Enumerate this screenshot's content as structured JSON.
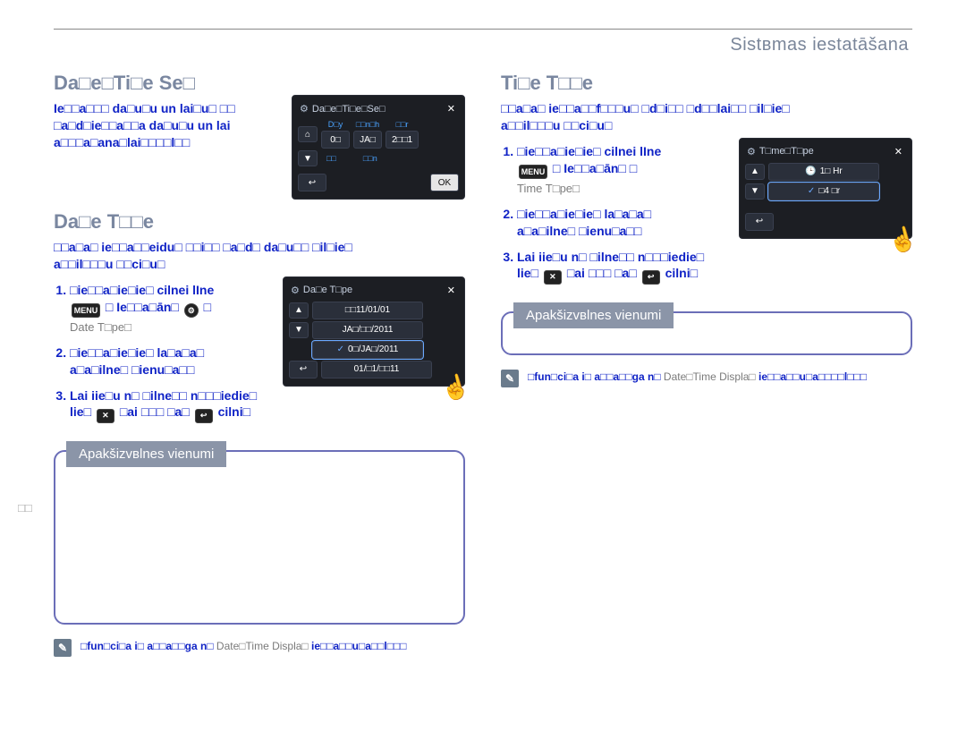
{
  "header_right": "Sistвmas iestatāšana",
  "left": {
    "h1": "Da□e□Ti□e Se□",
    "lede": "Ie□□a□□□ da□u□u un lai□u□ □□\n□a□d□ie□□a□□a da□u□u un lai\na□□□a□ana□lai□□□□l□□",
    "h2": "Da□e T□□e",
    "lede2": "□□a□a□ ie□□a□□eidu□ □□i□□ □a□d□ da□u□□ □il□ie□\na□□il□□□u □□ci□u□",
    "steps": [
      "□ie□□a□ie□ie□ cilnei lIne",
      "□ie□□a□ie□ie□ la□a□a□\na□a□ilne□ □ienu□a□□",
      "Lai iie□u n□ □ilne□□ n□□□iedie□\nlie□"
    ],
    "step1_tail_a": "□ Ie□□a□ān□",
    "step1_tail_b": "□",
    "step1_sub": "Date T□pe□",
    "step3_mid": "□ai □□□ □a□",
    "step3_tail": " cilni□",
    "callout_title": "Apakšizvвlnes vienumi",
    "note": {
      "pre": "□fun□ci□a i□ a□□a□□ga n□ ",
      "grey": "Date□Time Displa□",
      "post": " ie□□a□□u□a□□l□□□"
    }
  },
  "right": {
    "h1": "Ti□e T□□e",
    "lede": "□□a□a□ ie□□a□□f□□□u□ □d□i□□ □d□□lai□□ □il□ie□\na□□il□□□u □□ci□u□",
    "steps": [
      "□ie□□a□ie□ie□ cilnei lIne",
      "□ie□□a□ie□ie□ la□a□a□\na□a□ilne□ □ienu□a□□",
      "Lai iie□u n□ □ilne□□ n□□□iedie□\nlie□"
    ],
    "step1_tail_a": "□ Ie□□a□ān□ □",
    "step1_sub": "Time T□pe□",
    "step3_mid": "□ai □□□ □a□",
    "step3_tail": " cilni□",
    "callout_title": "Apakšizvвlnes vienumi",
    "note_pre": "□fun□ci□a i□ a□□a□□ga n□ ",
    "note_grey": "Date□Time Displa□",
    "note_post": " ie□□a□□u□a□□□□l□□□"
  },
  "page_num": "□□",
  "shot1": {
    "title": "Da□e□Ti□e□Se□",
    "cols": [
      "D□y",
      "□□n□h",
      "□□r"
    ],
    "vals": [
      "0□",
      "JA□",
      "2□□1"
    ],
    "labels2": [
      "□□",
      "□□n"
    ],
    "ok": "OK"
  },
  "shot2": {
    "title": "Da□e T□pe",
    "rows": [
      "□□11/01/01",
      "JA□/□□/2011",
      "0□/JA□/2011",
      "01/□1/□□11"
    ]
  },
  "shot3": {
    "title": "T□me□T□pe",
    "rows": [
      "1□ Hr",
      "□4 □r"
    ],
    "sel_idx": 1
  },
  "icons": {
    "menu": "MENU",
    "gear": "⚙",
    "x": "✕",
    "back": "↩",
    "home": "⌂",
    "up": "▲",
    "down": "▼",
    "check": "✓",
    "clock": "🕒"
  }
}
